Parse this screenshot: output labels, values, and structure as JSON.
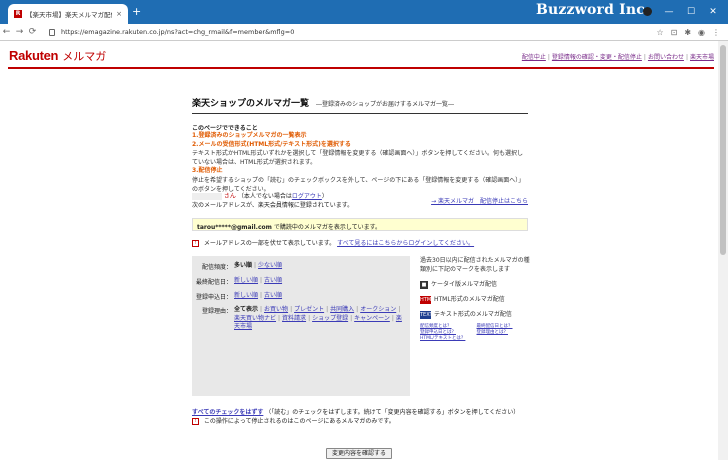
{
  "browser": {
    "tab_favicon": "R",
    "tab_title": "【楽天市場】楽天メルマガ配信停止",
    "tab_close": "×",
    "new_tab": "+",
    "brand": "Buzzword Inc.",
    "window_buttons": [
      "—",
      "☐",
      "✕"
    ],
    "nav_back": "←",
    "nav_forward": "→",
    "nav_reload": "⟳",
    "url": "https://emagazine.rakuten.co.jp/ns?act=chg_rmail&f=member&mflg=0",
    "addr_icons": [
      "☆",
      "⊡",
      "✱",
      "◉",
      "⋮"
    ]
  },
  "header": {
    "logo": "Rakuten",
    "logo_sub": "メルマガ",
    "links": [
      "配信中止",
      "登録情報の確認・変更・配信停止",
      "お問い合わせ",
      "楽天市場"
    ]
  },
  "main": {
    "title": "楽天ショップのメルマガ一覧",
    "subtitle": "―登録済みのショップがお届けするメルマガ一覧―",
    "can_do": "このページでできること",
    "step1": "1.登録済みのショップメルマガの一覧表示",
    "step2": "2.メールの受信形式(HTML形式/テキスト形式)を選択する",
    "step2_text": "テキスト形式かHTML形式いずれかを選択して「登録情報を変更する（確認画面へ）」ボタンを押してください。何も選択していない場合は、HTML形式が選択されます。",
    "step3": "3.配信停止",
    "step3_text": "停止を希望するショップの「読む」のチェックボックスを外して、ページの下にある「登録情報を変更する（確認画面へ）」のボタンを押してください。",
    "stop_link": "→ 楽天メルマガ　配信停止はこちら"
  },
  "user": {
    "san": "さん",
    "not_me": "（本人でない場合は",
    "logout": "ログアウト",
    "not_me_end": "）",
    "registered_line": "次のメールアドレスが、楽天会員情報に登録されています。",
    "email": "tarou*****@gmail.com",
    "email_suffix": "で購読中のメルマガを表示しています。",
    "notice_icon": "!",
    "notice": "メールアドレスの一部を伏せて表示しています。",
    "notice_link": "すべて見るにはこちらからログインしてください。"
  },
  "panel": {
    "rows": [
      {
        "label": "配信頻度：",
        "current": "多い順",
        "links": [
          "少ない順"
        ]
      },
      {
        "label": "最終配信日：",
        "current": "",
        "links": [
          "新しい順",
          "古い順"
        ]
      },
      {
        "label": "登録申込日：",
        "current": "",
        "links": [
          "新しい順",
          "古い順"
        ]
      },
      {
        "label": "登録理由：",
        "current": "全て表示",
        "links": [
          "お買い物",
          "プレゼント",
          "共同購入",
          "オークション",
          "楽天買い物ナビ",
          "資料請求",
          "ショップ登録",
          "キャンペーン",
          "楽天市場"
        ]
      }
    ]
  },
  "legend": {
    "intro": "過去30日以内に配信されたメルマガの種類別に下記のマークを表示します",
    "items": [
      {
        "icon": "■",
        "text": "ケータイ版メルマガ配信"
      },
      {
        "icon": "HTML",
        "text": "HTML形式のメルマガ配信"
      },
      {
        "icon": "TEXT",
        "text": "テキスト形式のメルマガ配信"
      }
    ],
    "minilinks": [
      "配信頻度とは？",
      "最終配信日とは？",
      "登録申込日とは？",
      "登録理由とは？",
      "HTML/テキストとは？"
    ]
  },
  "bottom": {
    "uncheck_all": "すべてのチェックをはずす",
    "uncheck_text": "（「読む」のチェックをはずします。続けて「変更内容を確認する」ボタンを押してください）",
    "note": "この操作によって停止されるのはこのページにあるメルマガのみです。",
    "confirm_button": "変更内容を確認する"
  }
}
